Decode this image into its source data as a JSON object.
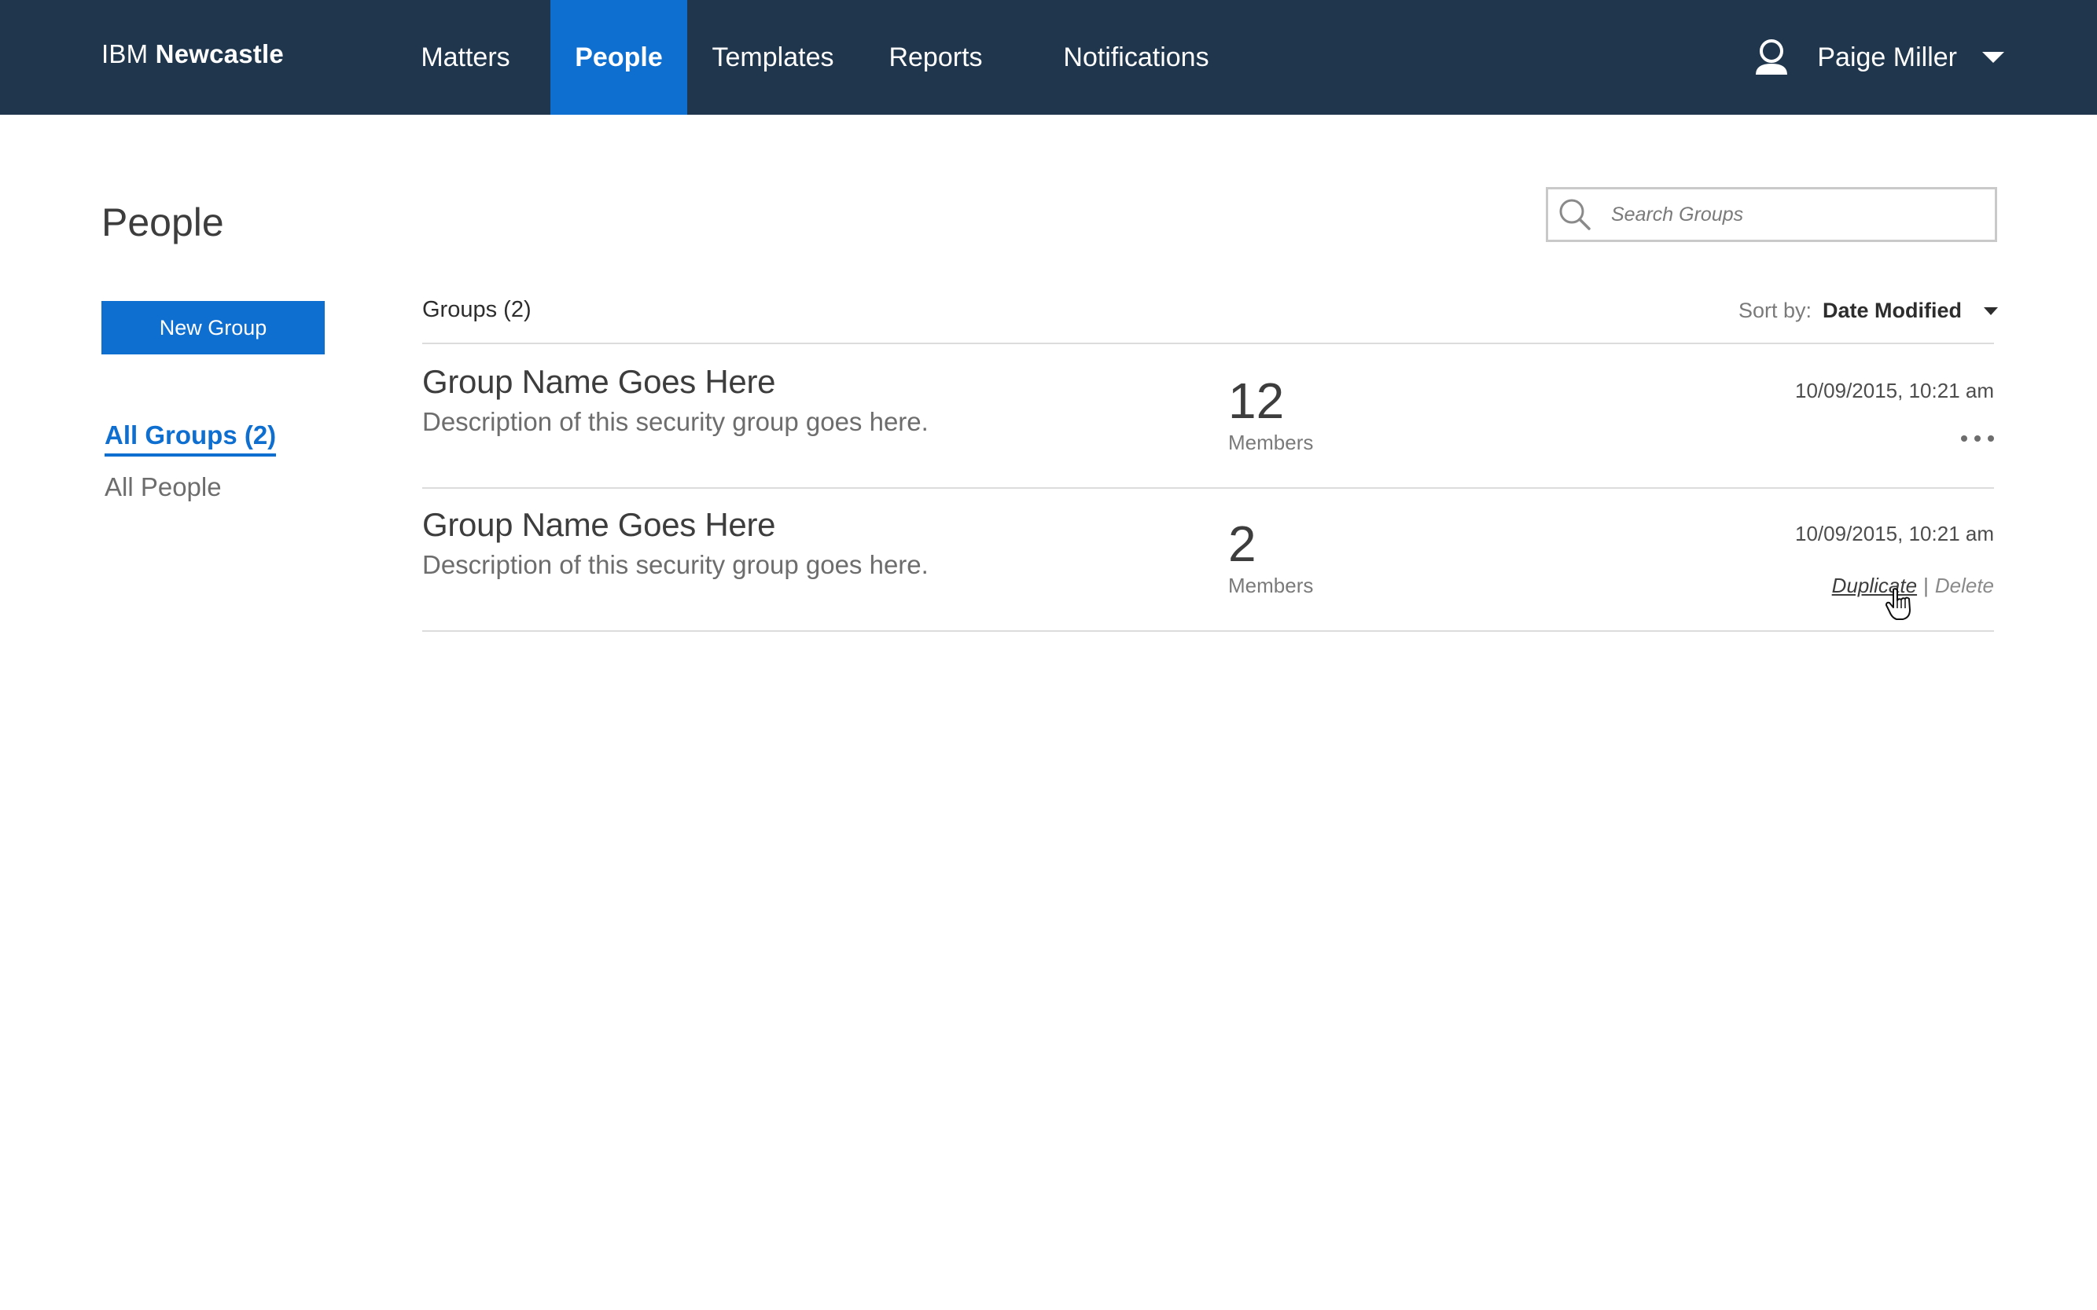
{
  "header": {
    "brand_prefix": "IBM",
    "brand_name": "Newcastle",
    "nav": [
      {
        "label": "Matters",
        "active": false
      },
      {
        "label": "People",
        "active": true
      },
      {
        "label": "Templates",
        "active": false
      },
      {
        "label": "Reports",
        "active": false
      },
      {
        "label": "Notifications",
        "active": false
      }
    ],
    "user_name": "Paige Miller",
    "user_icon": "user-icon"
  },
  "page": {
    "title": "People",
    "new_group_label": "New Group"
  },
  "search": {
    "placeholder": "Search Groups",
    "value": ""
  },
  "sidebar": {
    "items": [
      {
        "label": "All Groups (2)",
        "active": true
      },
      {
        "label": "All People",
        "active": false
      }
    ]
  },
  "groups": {
    "heading": "Groups (2)",
    "sort_label": "Sort by:",
    "sort_value": "Date Modified",
    "rows": [
      {
        "name": "Group Name Goes Here",
        "description": "Description of this security group goes here.",
        "member_count": "12",
        "member_label": "Members",
        "date": "10/09/2015, 10:21 am"
      },
      {
        "name": "Group Name Goes Here",
        "description": "Description of this security group goes here.",
        "member_count": "2",
        "member_label": "Members",
        "date": "10/09/2015, 10:21 am",
        "actions": {
          "duplicate": "Duplicate",
          "separator": "|",
          "delete": "Delete"
        }
      }
    ]
  },
  "colors": {
    "header_bg": "#1f364c",
    "accent": "#0f6fd1"
  }
}
